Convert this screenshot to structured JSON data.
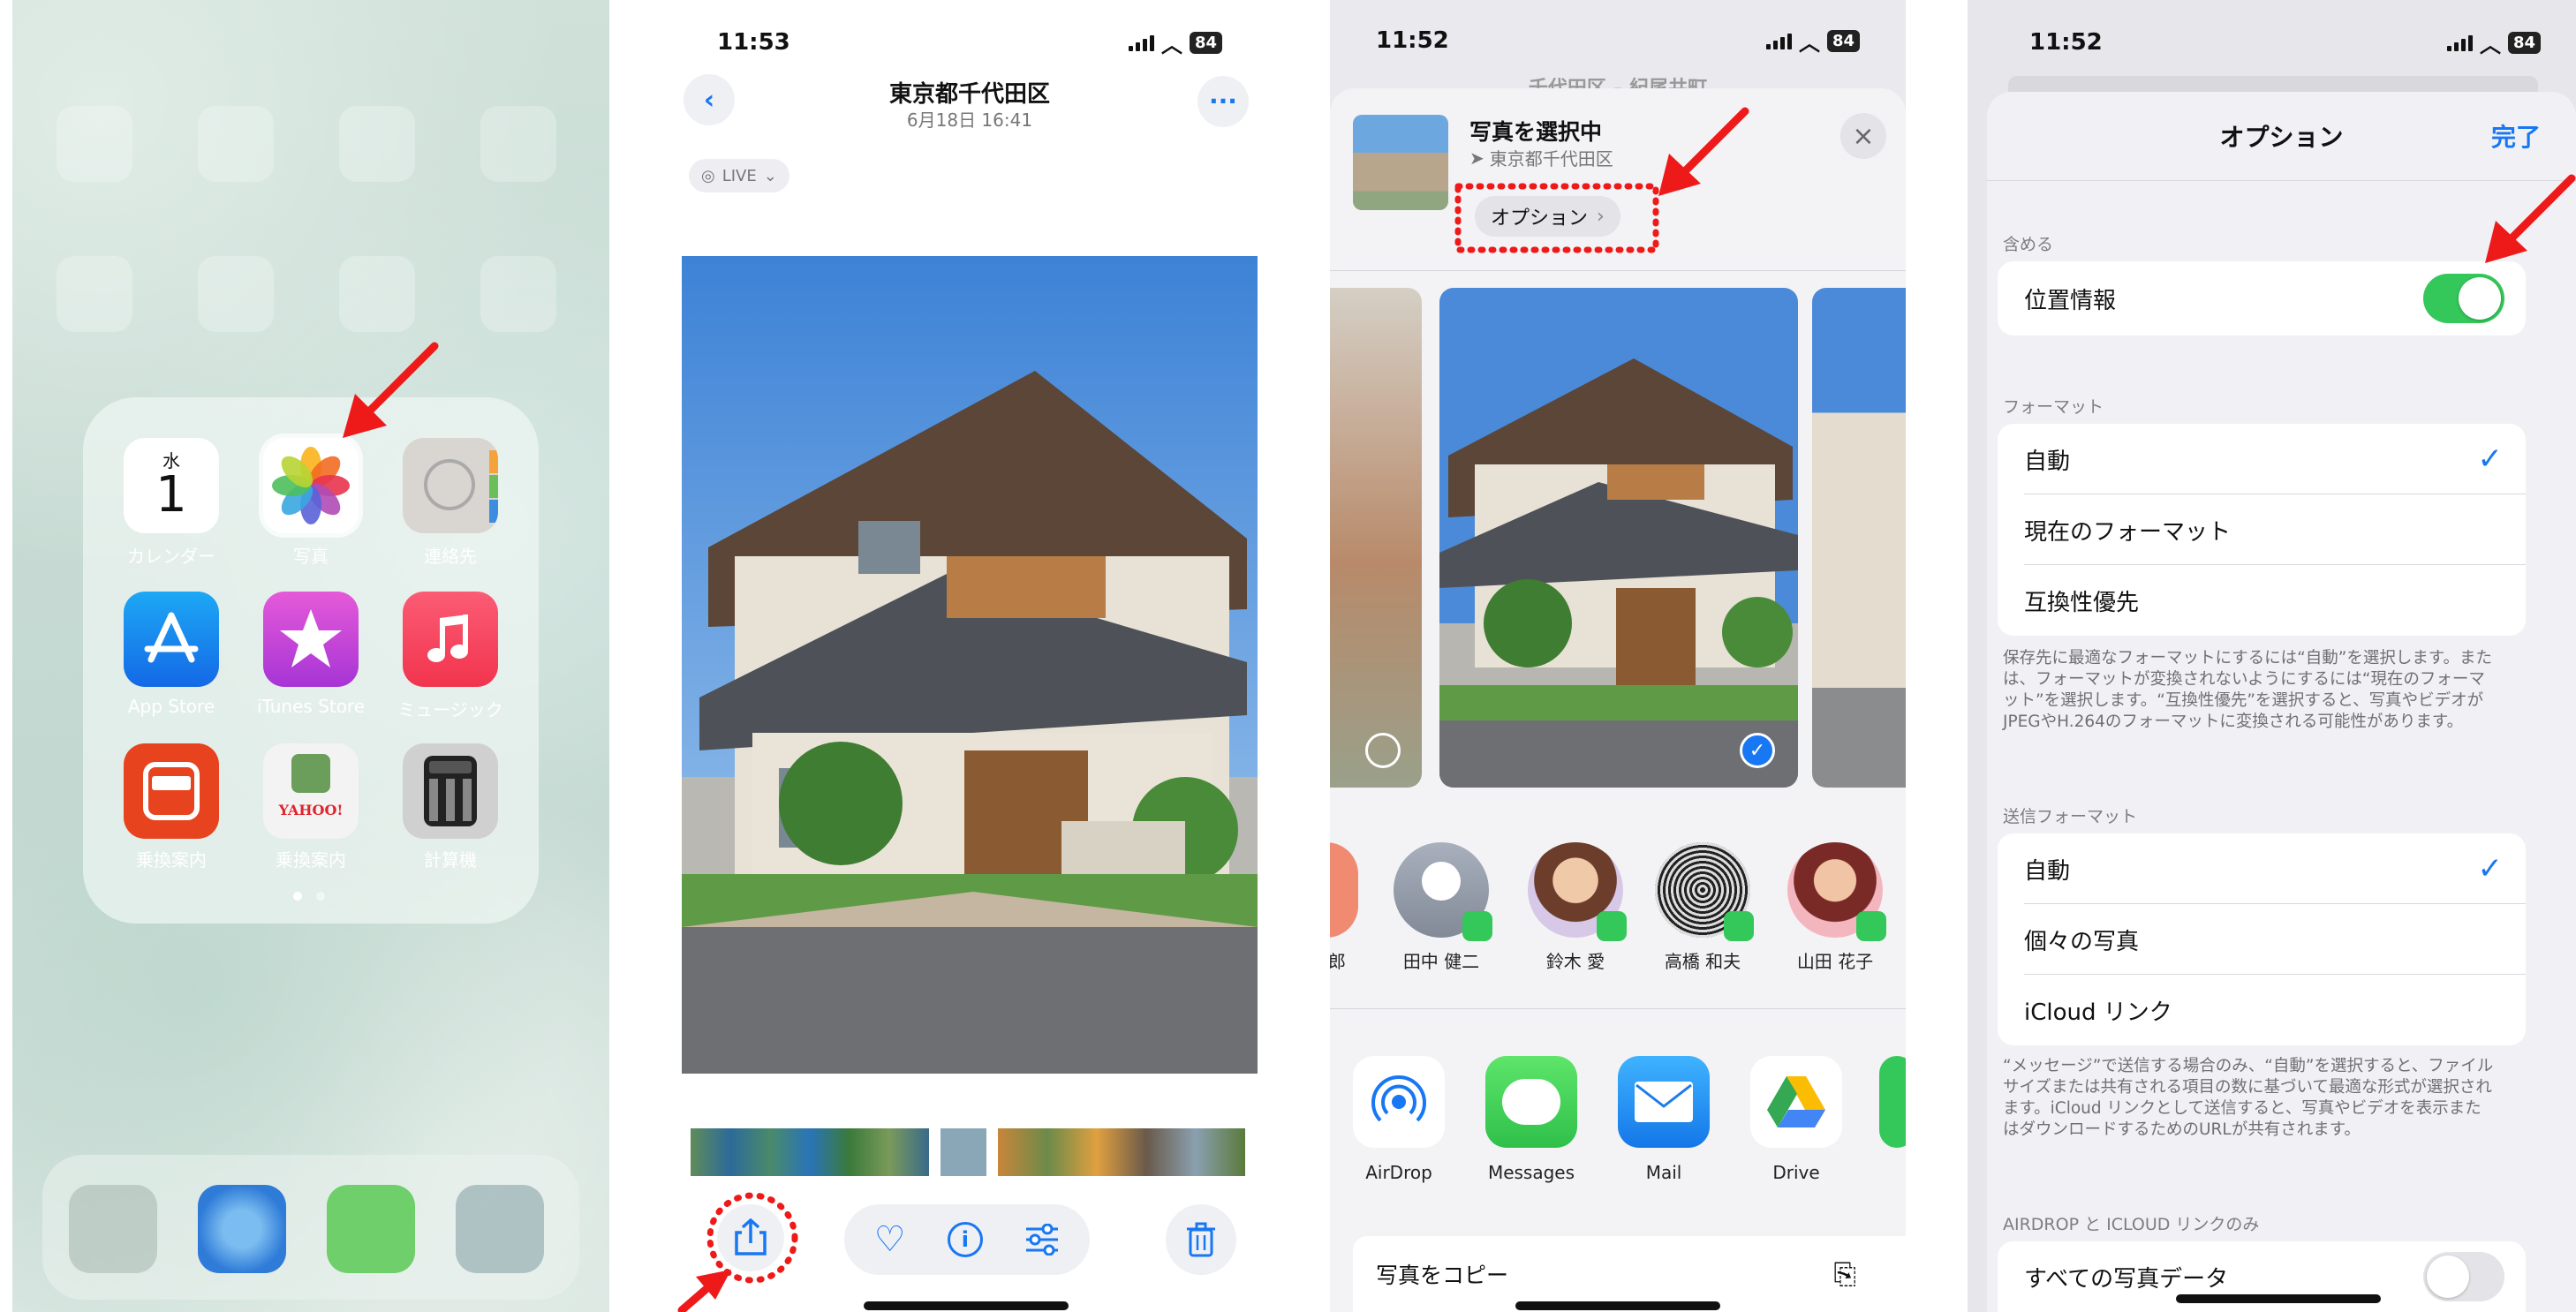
{
  "colors": {
    "accent": "#1877f2",
    "toggle_on": "#34c759",
    "arrow": "#ee1a1a"
  },
  "home": {
    "apps": [
      {
        "label": "カレンダー",
        "day": "水",
        "date": "1",
        "icon": "calendar-icon"
      },
      {
        "label": "写真",
        "icon": "photos-icon"
      },
      {
        "label": "連絡先",
        "icon": "contacts-icon"
      },
      {
        "label": "App Store",
        "icon": "app-store-icon"
      },
      {
        "label": "iTunes Store",
        "icon": "star-icon"
      },
      {
        "label": "ミュージック",
        "icon": "music-note-icon"
      },
      {
        "label": "乗換案内",
        "icon": "train-icon"
      },
      {
        "label": "乗換案内",
        "icon": "yahoo-train-icon",
        "logo": "YAHOO!"
      },
      {
        "label": "計算機",
        "icon": "calculator-icon"
      }
    ]
  },
  "photo": {
    "time": "11:53",
    "battery": "84",
    "title": "東京都千代田区",
    "subtitle": "6月18日  16:41",
    "live_label": "LIVE",
    "icons": [
      "back-chevron-icon",
      "more-icon",
      "share-icon",
      "heart-icon",
      "info-icon",
      "adjust-icon",
      "trash-icon"
    ]
  },
  "share": {
    "time": "11:52",
    "battery": "84",
    "behind_title": "千代田区 – 紀尾井町",
    "header_title": "写真を選択中",
    "header_location": "東京都千代田区",
    "options_button": "オプション",
    "contacts": [
      "郎",
      "田中 健二",
      "鈴木 愛",
      "高橋 和夫",
      "山田 花子"
    ],
    "apps": [
      "AirDrop",
      "Messages",
      "Mail",
      "Drive"
    ],
    "copy_label": "写真をコピー"
  },
  "options": {
    "time": "11:52",
    "battery": "84",
    "title": "オプション",
    "done": "完了",
    "include_header": "含める",
    "location_label": "位置情報",
    "location_on": true,
    "format_header": "フォーマット",
    "format_items": [
      "自動",
      "現在のフォーマット",
      "互換性優先"
    ],
    "format_note": "保存先に最適なフォーマットにするには“自動”を選択します。または、フォーマットが変換されないようにするには“現在のフォーマット”を選択します。“互換性優先”を選択すると、写真やビデオがJPEGやH.264のフォーマットに変換される可能性があります。",
    "send_header": "送信フォーマット",
    "send_items": [
      "自動",
      "個々の写真",
      "iCloud リンク"
    ],
    "send_note": "“メッセージ”で送信する場合のみ、“自動”を選択すると、ファイルサイズまたは共有される項目の数に基づいて最適な形式が選択されます。iCloud リンクとして送信すると、写真やビデオを表示またはダウンロードするためのURLが共有されます。",
    "airdrop_header": "AIRDROP と ICLOUD リンクのみ",
    "all_data_label": "すべての写真データ",
    "all_data_on": false
  }
}
